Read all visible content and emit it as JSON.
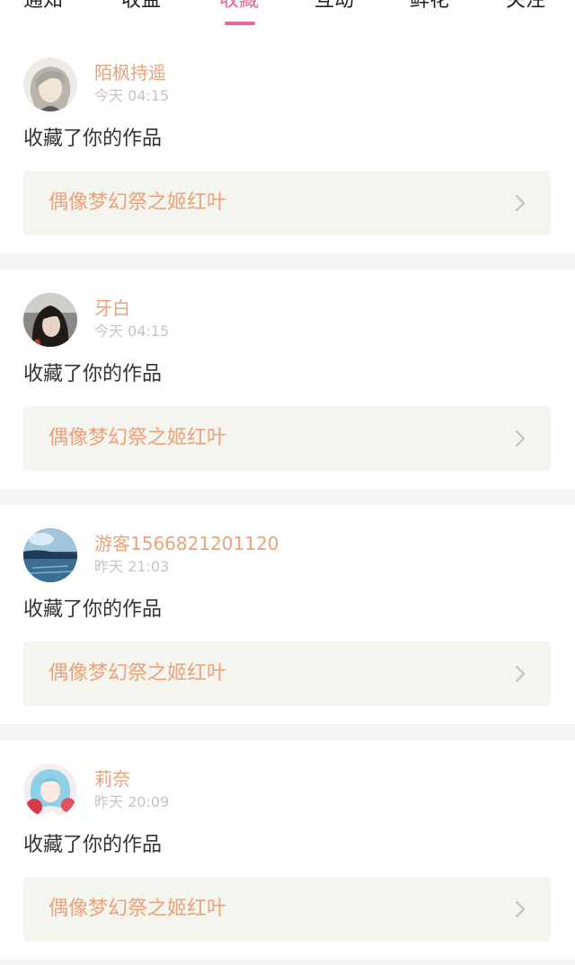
{
  "tabs": [
    {
      "label": "通知"
    },
    {
      "label": "收益"
    },
    {
      "label": "收藏"
    },
    {
      "label": "互动"
    },
    {
      "label": "鲜花"
    },
    {
      "label": "关注"
    }
  ],
  "active_tab": "收藏",
  "colors": {
    "accent": "#e8679a",
    "name": "#e9a27a",
    "time": "#c4c4c4",
    "card_link_bg": "#f5f5ef"
  },
  "notifications": [
    {
      "username": "陌枫持遥",
      "time": "今天 04:15",
      "action": "收藏了你的作品",
      "work_title": "偶像梦幻祭之姬红叶"
    },
    {
      "username": "牙白",
      "time": "今天 04:15",
      "action": "收藏了你的作品",
      "work_title": "偶像梦幻祭之姬红叶"
    },
    {
      "username": "游客1566821201120",
      "time": "昨天 21:03",
      "action": "收藏了你的作品",
      "work_title": "偶像梦幻祭之姬红叶"
    },
    {
      "username": "莉奈",
      "time": "昨天 20:09",
      "action": "收藏了你的作品",
      "work_title": "偶像梦幻祭之姬红叶"
    }
  ]
}
